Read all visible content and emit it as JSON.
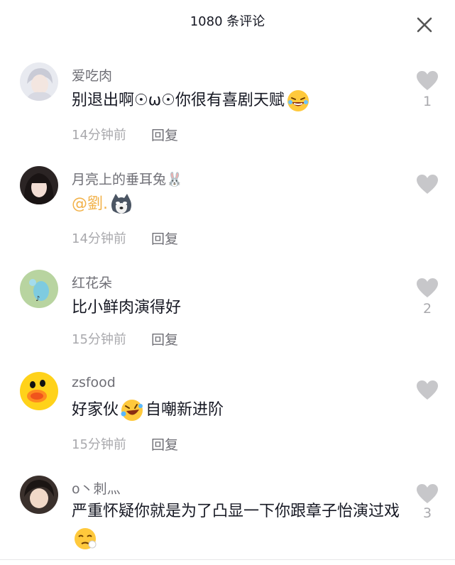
{
  "header": {
    "title": "1080 条评论"
  },
  "comments": [
    {
      "username": "爱吃肉",
      "text_before": "别退出啊☉ω☉你很有喜剧天赋",
      "text_after": "",
      "time": "14分钟前",
      "reply": "回复",
      "likes": "1"
    },
    {
      "username": "月亮上的垂耳兔🐰",
      "mention": "@劉.",
      "time": "14分钟前",
      "reply": "回复",
      "likes": ""
    },
    {
      "username": "红花朵",
      "text_before": "比小鲜肉演得好",
      "time": "15分钟前",
      "reply": "回复",
      "likes": "2"
    },
    {
      "username": "zsfood",
      "text_before": "好家伙",
      "text_after": "自嘲新进阶",
      "time": "15分钟前",
      "reply": "回复",
      "likes": ""
    },
    {
      "username": "o丶刺灬",
      "text_before": "严重怀疑你就是为了凸显一下你跟章子怡演过戏",
      "likes": "3"
    }
  ]
}
